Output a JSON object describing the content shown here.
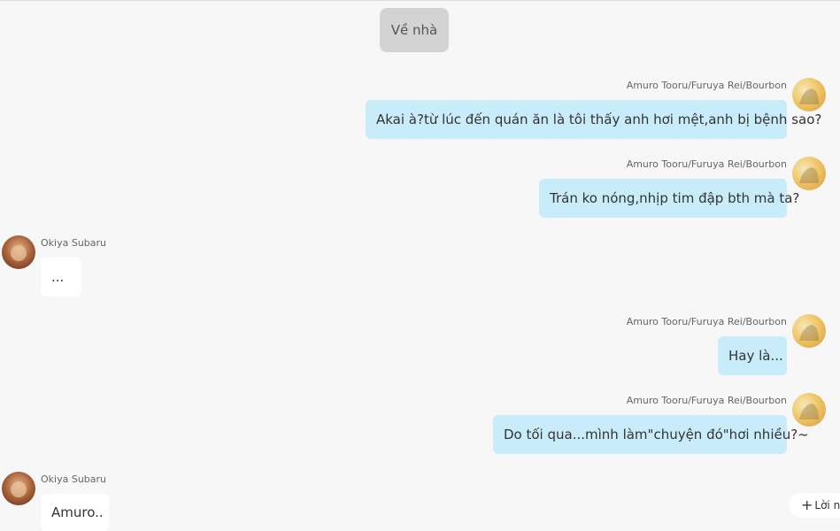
{
  "scene": {
    "label": "Về nhà"
  },
  "messages": [
    {
      "speaker": "Amuro Tooru/Furuya Rei/Bourbon",
      "text": "Akai à?từ lúc đến quán ăn là tôi thấy anh hơi mệt,anh bị bệnh sao?",
      "side": "right"
    },
    {
      "speaker": "Amuro Tooru/Furuya Rei/Bourbon",
      "text": "Trán ko nóng,nhịp tim đập bth mà ta?",
      "side": "right"
    },
    {
      "speaker": "Okiya Subaru",
      "text": "...",
      "side": "left"
    },
    {
      "speaker": "Amuro Tooru/Furuya Rei/Bourbon",
      "text": "Hay là...",
      "side": "right"
    },
    {
      "speaker": "Amuro Tooru/Furuya Rei/Bourbon",
      "text": "Do tối qua...mình làm\"chuyện đó\"hơi nhiều?~",
      "side": "right"
    },
    {
      "speaker": "Okiya Subaru",
      "text": "Amuro..",
      "side": "left"
    }
  ],
  "reply_button": {
    "icon": "plus-icon",
    "label": "Lời nh"
  },
  "colors": {
    "bubble_right": "#c9ecfb",
    "bubble_left": "#ffffff",
    "background": "#f7f7f7",
    "chip": "#d3d3d3"
  }
}
